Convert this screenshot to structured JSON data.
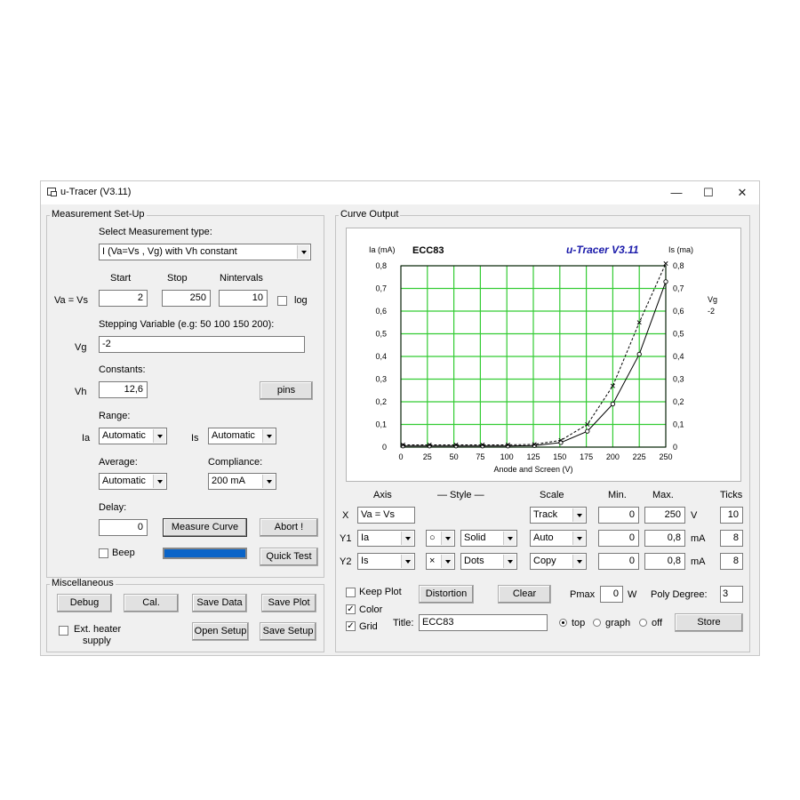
{
  "window": {
    "title": "u-Tracer (V3.11)",
    "controls": {
      "minimize": "—",
      "maximize": "☐",
      "close": "✕"
    }
  },
  "setup": {
    "group_label": "Measurement Set-Up",
    "select_type_label": "Select Measurement type:",
    "measurement_type": "I (Va=Vs , Vg) with Vh constant",
    "start_label": "Start",
    "stop_label": "Stop",
    "nintervals_label": "Nintervals",
    "va_label": "Va = Vs",
    "start": "2",
    "stop": "250",
    "nintervals": "10",
    "log_label": "log",
    "log_checked": false,
    "stepping_label": "Stepping Variable (e.g: 50 100 150 200):",
    "vg_label": "Vg",
    "stepping_value": "-2",
    "constants_label": "Constants:",
    "vh_label": "Vh",
    "vh_value": "12,6",
    "pins_label": "pins",
    "range_label": "Range:",
    "ia_label": "Ia",
    "ia_range": "Automatic",
    "is_label": "Is",
    "is_range": "Automatic",
    "average_label": "Average:",
    "average_value": "Automatic",
    "compliance_label": "Compliance:",
    "compliance_value": "200 mA",
    "delay_label": "Delay:",
    "delay_value": "0",
    "measure_label": "Measure Curve",
    "abort_label": "Abort !",
    "beep_label": "Beep",
    "beep_checked": false,
    "quicktest_label": "Quick Test",
    "progress": 1.0
  },
  "misc": {
    "group_label": "Miscellaneous",
    "debug_label": "Debug",
    "cal_label": "Cal.",
    "save_data_label": "Save Data",
    "save_plot_label": "Save Plot",
    "ext_heater_line1": "Ext. heater",
    "ext_heater_line2": "supply",
    "ext_heater_checked": false,
    "open_setup_label": "Open Setup",
    "save_setup_label": "Save Setup"
  },
  "curve": {
    "group_label": "Curve Output",
    "table": {
      "axis_header": "Axis",
      "style_header": "— Style —",
      "scale_header": "Scale",
      "min_header": "Min.",
      "max_header": "Max.",
      "ticks_header": "Ticks",
      "rows": [
        {
          "label": "X",
          "axis": "Va = Vs",
          "marker": "",
          "style": "",
          "scale": "Track",
          "min": "0",
          "max": "250",
          "unit": "V",
          "ticks": "10"
        },
        {
          "label": "Y1",
          "axis": "Ia",
          "marker": "○",
          "style": "Solid",
          "scale": "Auto",
          "min": "0",
          "max": "0,8",
          "unit": "mA",
          "ticks": "8"
        },
        {
          "label": "Y2",
          "axis": "Is",
          "marker": "×",
          "style": "Dots",
          "scale": "Copy",
          "min": "0",
          "max": "0,8",
          "unit": "mA",
          "ticks": "8"
        }
      ]
    },
    "keep_plot_label": "Keep Plot",
    "keep_plot_checked": false,
    "color_label": "Color",
    "color_checked": true,
    "grid_label": "Grid",
    "grid_checked": true,
    "distortion_label": "Distortion",
    "clear_label": "Clear",
    "pmax_label": "Pmax",
    "pmax_value": "0",
    "pmax_unit": "W",
    "poly_label": "Poly Degree:",
    "poly_value": "3",
    "title_label": "Title:",
    "title_value": "ECC83",
    "top_label": "top",
    "graph_label": "graph",
    "off_label": "off",
    "title_position": "top",
    "store_label": "Store"
  },
  "chart_data": {
    "type": "line",
    "title": "ECC83",
    "brand": "u-Tracer V3.11",
    "xlabel": "Anode and Screen (V)",
    "ylabel": "Ia (mA)",
    "y2label": "Is (ma)",
    "xlim": [
      0,
      250
    ],
    "ylim": [
      0,
      0.8
    ],
    "x_ticks": [
      "0",
      "25",
      "50",
      "75",
      "100",
      "125",
      "150",
      "175",
      "200",
      "225",
      "250"
    ],
    "y_ticks": [
      "0",
      "0,1",
      "0,2",
      "0,3",
      "0,4",
      "0,5",
      "0,6",
      "0,7",
      "0,8"
    ],
    "grid": true,
    "grid_color": "#33cc33",
    "legend": {
      "title": "Vg",
      "entries": [
        "-2"
      ],
      "placement": "right"
    },
    "x": [
      2,
      27,
      52,
      77,
      101,
      126,
      151,
      176,
      200,
      225,
      250
    ],
    "series": [
      {
        "name": "Ia",
        "style": "solid",
        "marker": "circle",
        "values": [
          0.005,
          0.005,
          0.005,
          0.005,
          0.005,
          0.007,
          0.02,
          0.07,
          0.19,
          0.41,
          0.73
        ]
      },
      {
        "name": "Is",
        "style": "dotted",
        "marker": "x",
        "values": [
          0.01,
          0.01,
          0.01,
          0.01,
          0.01,
          0.012,
          0.03,
          0.1,
          0.27,
          0.55,
          0.81
        ]
      }
    ]
  }
}
